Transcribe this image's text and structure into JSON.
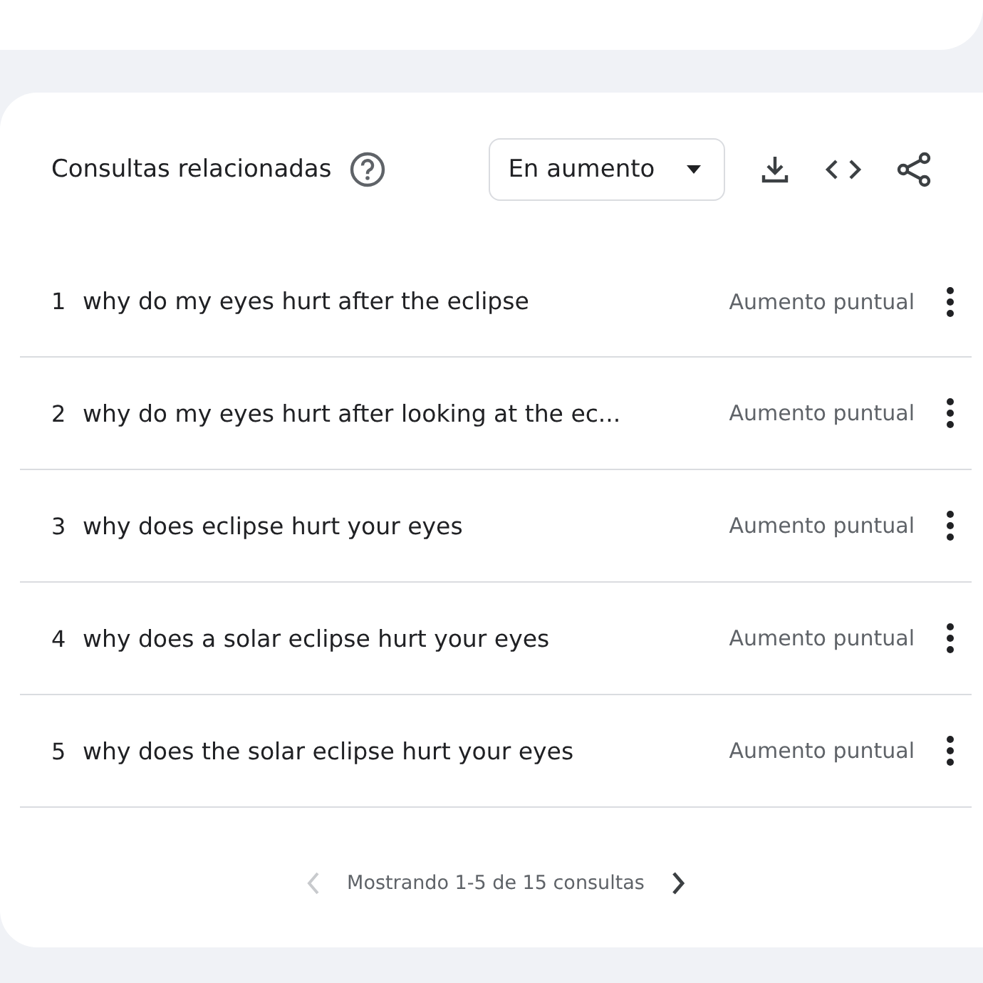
{
  "header": {
    "title": "Consultas relacionadas",
    "dropdown": {
      "value": "En aumento"
    }
  },
  "rows": [
    {
      "rank": "1",
      "query": "why do my eyes hurt after the eclipse",
      "trend": "Aumento puntual"
    },
    {
      "rank": "2",
      "query": "why do my eyes hurt after looking at the ec...",
      "trend": "Aumento puntual"
    },
    {
      "rank": "3",
      "query": "why does eclipse hurt your eyes",
      "trend": "Aumento puntual"
    },
    {
      "rank": "4",
      "query": "why does a solar eclipse hurt your eyes",
      "trend": "Aumento puntual"
    },
    {
      "rank": "5",
      "query": "why does the solar eclipse hurt your eyes",
      "trend": "Aumento puntual"
    }
  ],
  "pager": {
    "text": "Mostrando 1-5 de 15 consultas",
    "prev_disabled": true,
    "next_disabled": false
  }
}
